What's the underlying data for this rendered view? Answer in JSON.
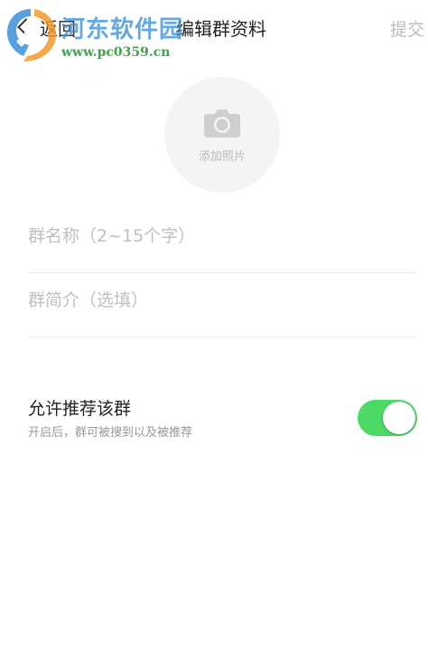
{
  "navbar": {
    "back_label": "返回",
    "title": "编辑群资料",
    "submit_label": "提交"
  },
  "watermark": {
    "site_name": "河东软件园",
    "url": "www.pc0359.cn"
  },
  "photo": {
    "label": "添加照片"
  },
  "fields": {
    "name": {
      "value": "",
      "placeholder": "群名称（2~15个字）"
    },
    "intro": {
      "value": "",
      "placeholder": "群简介（选填）"
    }
  },
  "recommend": {
    "title": "允许推荐该群",
    "subtitle": "开启后，群可被搜到以及被推荐",
    "enabled": true
  },
  "colors": {
    "toggle_on": "#4cd964",
    "submit_disabled": "#bbbbbb"
  },
  "icons": [
    "back-chevron-icon",
    "camera-icon",
    "site-logo-icon"
  ]
}
